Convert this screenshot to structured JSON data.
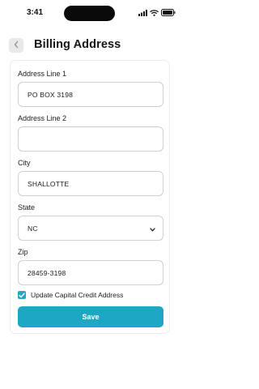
{
  "status_bar": {
    "time": "3:41"
  },
  "header": {
    "title": "Billing Address"
  },
  "form": {
    "address1": {
      "label": "Address Line 1",
      "value": "PO BOX 3198"
    },
    "address2": {
      "label": "Address Line 2",
      "value": ""
    },
    "city": {
      "label": "City",
      "value": "SHALLOTTE"
    },
    "state": {
      "label": "State",
      "value": "NC"
    },
    "zip": {
      "label": "Zip",
      "value": "28459-3198"
    },
    "update_capital_credit": {
      "label": "Update Capital Credit Address",
      "checked": true
    },
    "save_label": "Save"
  },
  "colors": {
    "accent": "#1ea7c4",
    "checkbox": "#2aa6c4"
  },
  "icons": {
    "signal": "signal-icon",
    "wifi": "wifi-icon",
    "battery": "battery-icon",
    "back": "chevron-left-icon",
    "select": "chevron-down-icon",
    "check": "check-icon"
  }
}
